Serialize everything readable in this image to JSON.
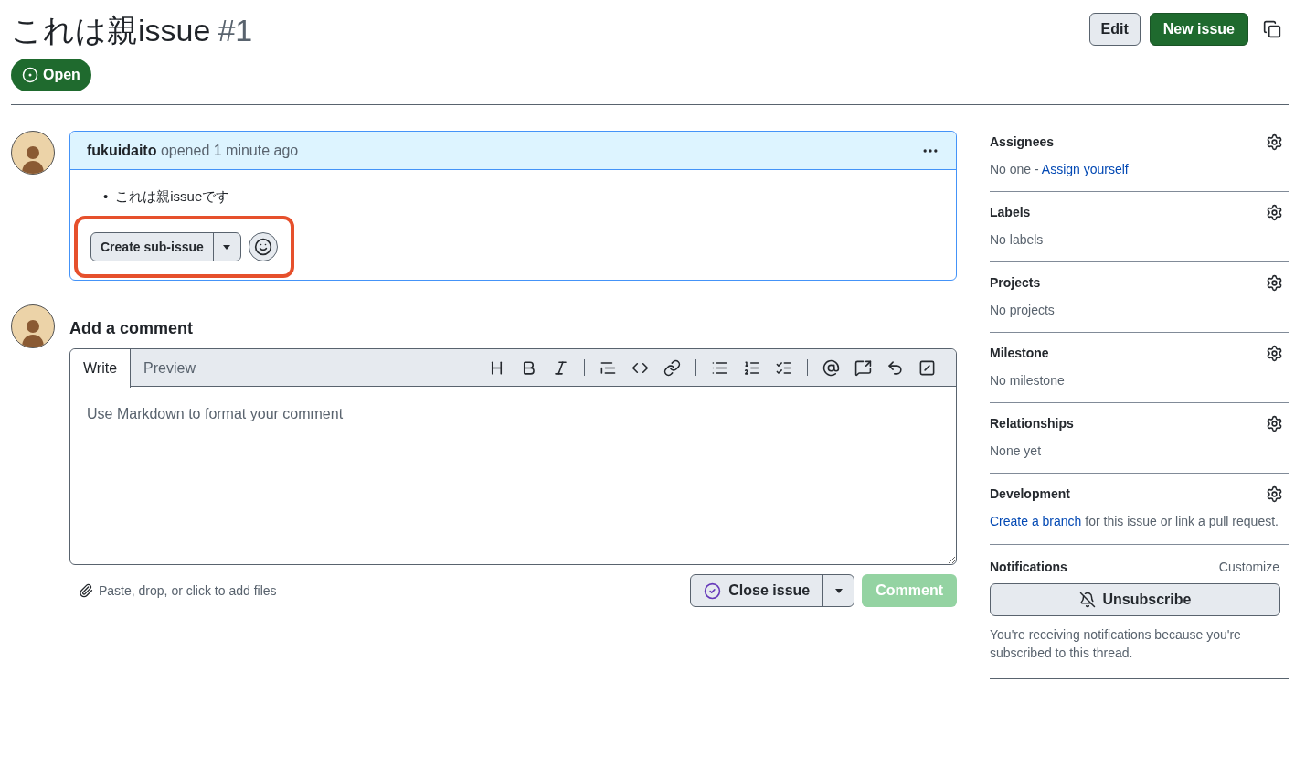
{
  "header": {
    "title": "これは親issue",
    "number": "#1",
    "buttons": [
      {
        "label": "Edit",
        "kind": "default"
      },
      {
        "label": "New issue",
        "kind": "primary"
      }
    ],
    "status": "Open"
  },
  "comment": {
    "author": "fukuidaito",
    "meta": "opened 1 minute ago",
    "body": [
      {
        "marker": "•",
        "text": "これは親issueです"
      }
    ],
    "sub_issue_button": "Create sub-issue",
    "highlighted": true
  },
  "composer": {
    "heading": "Add a comment",
    "tabs": [
      {
        "label": "Write",
        "selected": true
      },
      {
        "label": "Preview",
        "selected": false
      }
    ],
    "placeholder": "Use Markdown to format your comment",
    "attach": "Paste, drop, or click to add files",
    "close_button": "Close issue",
    "comment_button": {
      "label": "Comment",
      "disabled": true
    }
  },
  "sidebar": {
    "sections": [
      {
        "title": "Assignees",
        "kind": "prefix-link",
        "text": "No one - ",
        "link": "Assign yourself"
      },
      {
        "title": "Labels",
        "kind": "plain",
        "text": "No labels"
      },
      {
        "title": "Projects",
        "kind": "plain",
        "text": "No projects"
      },
      {
        "title": "Milestone",
        "kind": "plain",
        "text": "No milestone"
      },
      {
        "title": "Relationships",
        "kind": "plain",
        "text": "None yet"
      },
      {
        "title": "Development",
        "kind": "link-suffix",
        "link": "Create a branch",
        "text": " for this issue or link a pull request."
      }
    ],
    "notifications": {
      "title": "Notifications",
      "action": "Customize",
      "button": "Unsubscribe",
      "note": "You're receiving notifications because you're subscribed to this thread."
    }
  }
}
